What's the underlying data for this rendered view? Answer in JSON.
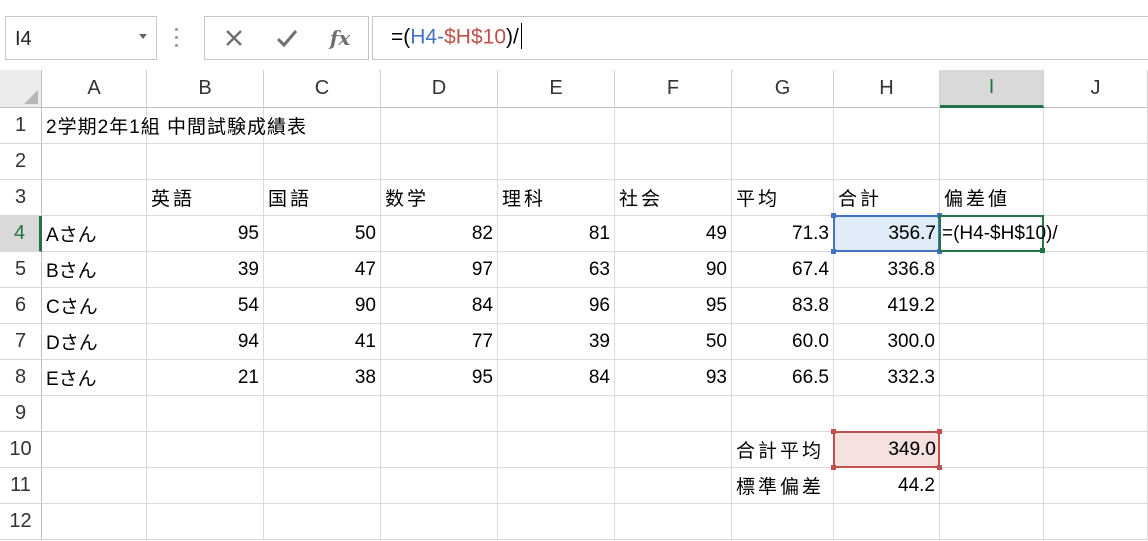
{
  "formula_bar": {
    "name_box": "I4",
    "cancel_icon": "x-icon",
    "enter_icon": "check-icon",
    "fx_label": "fx",
    "formula_prefix": "=(",
    "formula_ref1": "H4",
    "formula_op": "-",
    "formula_ref2": "$H$10",
    "formula_suffix": ")/"
  },
  "columns": [
    "A",
    "B",
    "C",
    "D",
    "E",
    "F",
    "G",
    "H",
    "I",
    "J"
  ],
  "rows": [
    "1",
    "2",
    "3",
    "4",
    "5",
    "6",
    "7",
    "8",
    "9",
    "10",
    "11",
    "12"
  ],
  "cells": {
    "A1": "2学期2年1組 中間試験成績表",
    "B3": "英語",
    "C3": "国語",
    "D3": "数学",
    "E3": "理科",
    "F3": "社会",
    "G3": "平均",
    "H3": "合計",
    "I3": "偏差値",
    "A4": "Aさん",
    "B4": "95",
    "C4": "50",
    "D4": "82",
    "E4": "81",
    "F4": "49",
    "G4": "71.3",
    "H4": "356.7",
    "A5": "Bさん",
    "B5": "39",
    "C5": "47",
    "D5": "97",
    "E5": "63",
    "F5": "90",
    "G5": "67.4",
    "H5": "336.8",
    "A6": "Cさん",
    "B6": "54",
    "C6": "90",
    "D6": "84",
    "E6": "96",
    "F6": "95",
    "G6": "83.8",
    "H6": "419.2",
    "A7": "Dさん",
    "B7": "94",
    "C7": "41",
    "D7": "77",
    "E7": "39",
    "F7": "50",
    "G7": "60.0",
    "H7": "300.0",
    "A8": "Eさん",
    "B8": "21",
    "C8": "38",
    "D8": "95",
    "E8": "84",
    "F8": "93",
    "G8": "66.5",
    "H8": "332.3",
    "G10": "合計平均",
    "H10": "349.0",
    "G11": "標準偏差",
    "H11": "44.2",
    "I4": "=(H4-$H$10)/"
  },
  "colors": {
    "accent_green": "#217346",
    "ref_blue": "#4472c4",
    "ref_red": "#c0504d"
  }
}
